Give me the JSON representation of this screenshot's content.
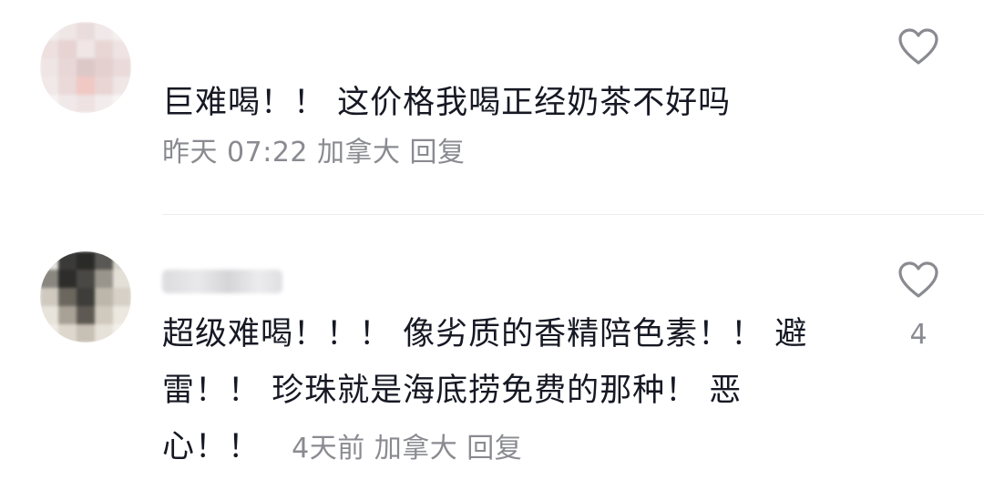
{
  "comments": [
    {
      "text": "巨难喝！！ 这价格我喝正经奶茶不好吗",
      "time": "昨天 07:22",
      "location": "加拿大",
      "reply_label": "回复",
      "like_count": "",
      "username": ""
    },
    {
      "text_line1": "超级难喝！！！ 像劣质的香精陪色素！！ 避",
      "text_line2": "雷！！ 珍珠就是海底捞免费的那种！ 恶",
      "text_line3": "心！！",
      "time": "4天前",
      "location": "加拿大",
      "reply_label": "回复",
      "like_count": "4"
    }
  ],
  "icons": {
    "like": "heart-outline-icon"
  },
  "colors": {
    "text": "#161823",
    "meta": "#8a8b91",
    "divider": "#ececee"
  }
}
